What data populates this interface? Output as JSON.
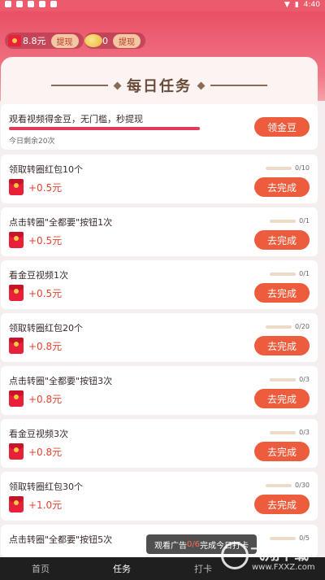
{
  "status_bar": {
    "time": "4:40"
  },
  "wallet": {
    "money": "8.8元",
    "beans": "0",
    "withdraw_label": "提现"
  },
  "page": {
    "title": "每日任务"
  },
  "watch_task": {
    "name": "观看视频得金豆，无门槛，秒提现",
    "remaining": "今日剩余20次",
    "button": "领金豆"
  },
  "tasks": [
    {
      "name": "领取转圈红包10个",
      "count": "0/10",
      "amount": "+0.5元",
      "button": "去完成"
    },
    {
      "name": "点击转圈\"全都要\"按钮1次",
      "count": "0/1",
      "amount": "+0.5元",
      "button": "去完成"
    },
    {
      "name": "看金豆视频1次",
      "count": "0/1",
      "amount": "+0.5元",
      "button": "去完成"
    },
    {
      "name": "领取转圈红包20个",
      "count": "0/20",
      "amount": "+0.8元",
      "button": "去完成"
    },
    {
      "name": "点击转圈\"全都要\"按钮3次",
      "count": "0/3",
      "amount": "+0.8元",
      "button": "去完成"
    },
    {
      "name": "看金豆视频3次",
      "count": "0/3",
      "amount": "+0.8元",
      "button": "去完成"
    },
    {
      "name": "领取转圈红包30个",
      "count": "0/30",
      "amount": "+1.0元",
      "button": "去完成"
    },
    {
      "name": "点击转圈\"全都要\"按钮5次",
      "count": "0/5",
      "amount": "",
      "button": ""
    }
  ],
  "toast": {
    "prefix": "观看广告",
    "progress": "0/6",
    "suffix": "完成今日打卡"
  },
  "nav": {
    "home": "首页",
    "tasks": "任务",
    "checkin": "打卡"
  },
  "watermark": {
    "brand": "飞翔下载",
    "url": "www.FXXZ.com"
  },
  "colors": {
    "accent": "#ed5c3c",
    "header": "#ea4f66",
    "amount": "#e4432f"
  }
}
